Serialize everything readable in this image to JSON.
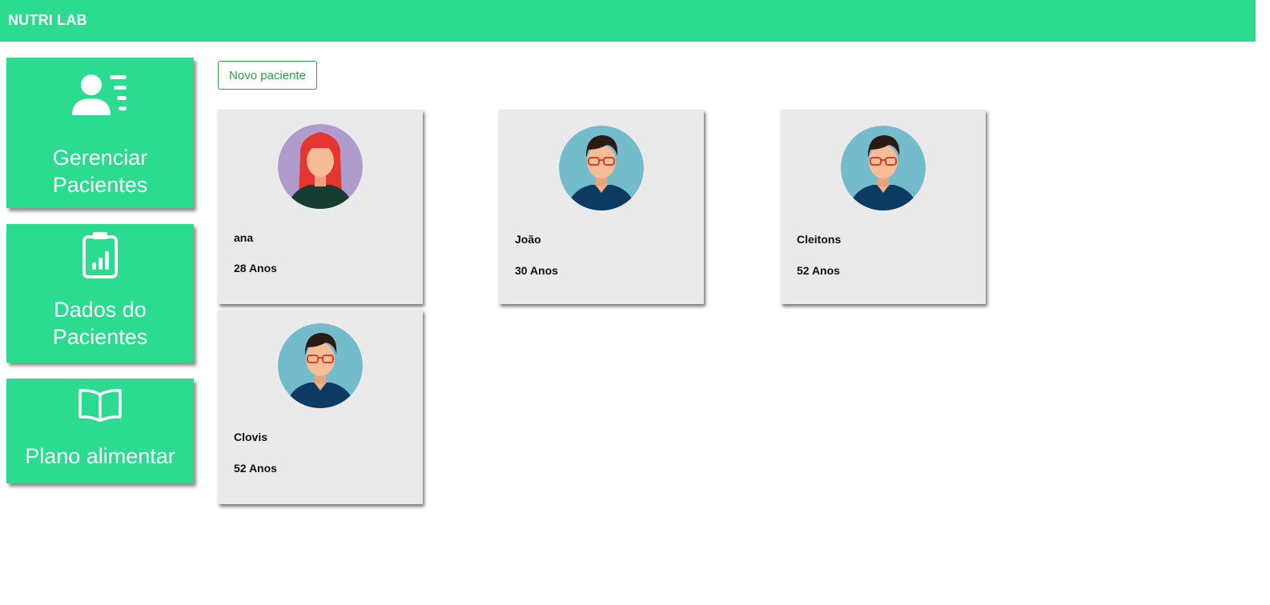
{
  "header": {
    "brand": "NUTRI LAB",
    "accent_color": "#2adb90"
  },
  "sidebar": {
    "items": [
      {
        "label": "Gerenciar Pacientes",
        "icon": "user-list-icon"
      },
      {
        "label": "Dados do Pacientes",
        "icon": "clipboard-chart-icon"
      },
      {
        "label": "Plano alimentar",
        "icon": "open-book-icon"
      }
    ]
  },
  "main": {
    "new_patient_label": "Novo paciente",
    "patients": [
      {
        "name": "ana",
        "age": "28 Anos",
        "avatar": "female-avatar-icon"
      },
      {
        "name": "João",
        "age": "30 Anos",
        "avatar": "male-avatar-icon"
      },
      {
        "name": "Cleitons",
        "age": "52 Anos",
        "avatar": "male-avatar-icon"
      },
      {
        "name": "Clovis",
        "age": "52 Anos",
        "avatar": "male-avatar-icon"
      }
    ]
  }
}
